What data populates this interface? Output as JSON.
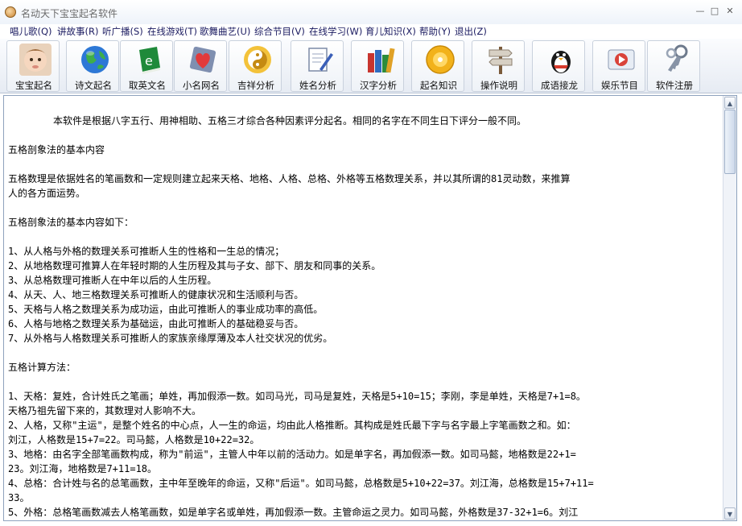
{
  "window": {
    "title": "名动天下宝宝起名软件"
  },
  "menu": [
    "唱儿歌(Q)",
    "讲故事(R)",
    "听广播(S)",
    "在线游戏(T)",
    "歌舞曲艺(U)",
    "综合节目(V)",
    "在线学习(W)",
    "育儿知识(X)",
    "帮助(Y)",
    "退出(Z)"
  ],
  "toolbar": [
    {
      "label": "宝宝起名",
      "icon": "baby-face-icon"
    },
    {
      "label": "诗文起名",
      "icon": "globe-icon"
    },
    {
      "label": "取英文名",
      "icon": "green-book-icon"
    },
    {
      "label": "小名网名",
      "icon": "heart-icon"
    },
    {
      "label": "吉祥分析",
      "icon": "taiji-icon"
    },
    {
      "label": "姓名分析",
      "icon": "document-pen-icon"
    },
    {
      "label": "汉字分析",
      "icon": "books-icon"
    },
    {
      "label": "起名知识",
      "icon": "cd-disc-icon"
    },
    {
      "label": "操作说明",
      "icon": "signpost-icon"
    },
    {
      "label": "成语接龙",
      "icon": "penguin-icon"
    },
    {
      "label": "娱乐节目",
      "icon": "media-icon"
    },
    {
      "label": "软件注册",
      "icon": "keys-icon"
    }
  ],
  "content": {
    "intro": "本软件是根据八字五行、用神相助、五格三才综合各种因素评分起名。相同的名字在不同生日下评分一般不同。",
    "heading1": "五格剖象法的基本内容",
    "para1": [
      "五格数理是依据姓名的笔画数和一定规则建立起来天格、地格、人格、总格、外格等五格数理关系，并以其所谓的81灵动数，来推算",
      "人的各方面运势。"
    ],
    "heading2": "五格剖象法的基本内容如下：",
    "list": [
      "1、从人格与外格的数理关系可推断人生的性格和一生总的情况；",
      "2、从地格数理可推算人在年轻时期的人生历程及其与子女、部下、朋友和同事的关系。",
      "3、从总格数理可推断人在中年以后的人生历程。",
      "4、从天、人、地三格数理关系可推断人的健康状况和生活顺利与否。",
      "5、天格与人格之数理关系为成功运，由此可推断人的事业成功率的高低。",
      "6、人格与地格之数理关系为基础运，由此可推断人的基础稳妥与否。",
      "7、从外格与人格数理关系可推断人的家族亲缘厚薄及本人社交状况的优劣。"
    ],
    "heading3": "五格计算方法：",
    "calc": [
      "1、天格：复姓，合计姓氏之笔画；单姓，再加假添一数。如司马光，司马是复姓，天格是5+10=15；李刚，李是单姓，天格是7+1=8。",
      "天格乃祖先留下来的，其数理对人影响不大。",
      "2、人格，又称\"主运\"，是整个姓名的中心点，人一生的命运，均由此人格推断。其构成是姓氏最下字与名字最上字笔画数之和。如：",
      "刘江，人格数是15+7=22。司马懿，人格数是10+22=32。",
      "3、地格：由名字全部笔画数构成，称为\"前运\"，主管人中年以前的活动力。如是单字名，再加假添一数。如司马懿，地格数是22+1=",
      "23。刘江海，地格数是7+11=18。",
      "4、总格：合计姓与名的总笔画数，主中年至晚年的命运，又称\"后运\"。如司马懿，总格数是5+10+22=37。刘江海，总格数是15+7+11=",
      "33。",
      "5、外格：总格笔画数减去人格笔画数，如是单字名或单姓，再加假添一数。主管命运之灵力。如司马懿，外格数是37-32+1=6。刘江"
    ]
  }
}
